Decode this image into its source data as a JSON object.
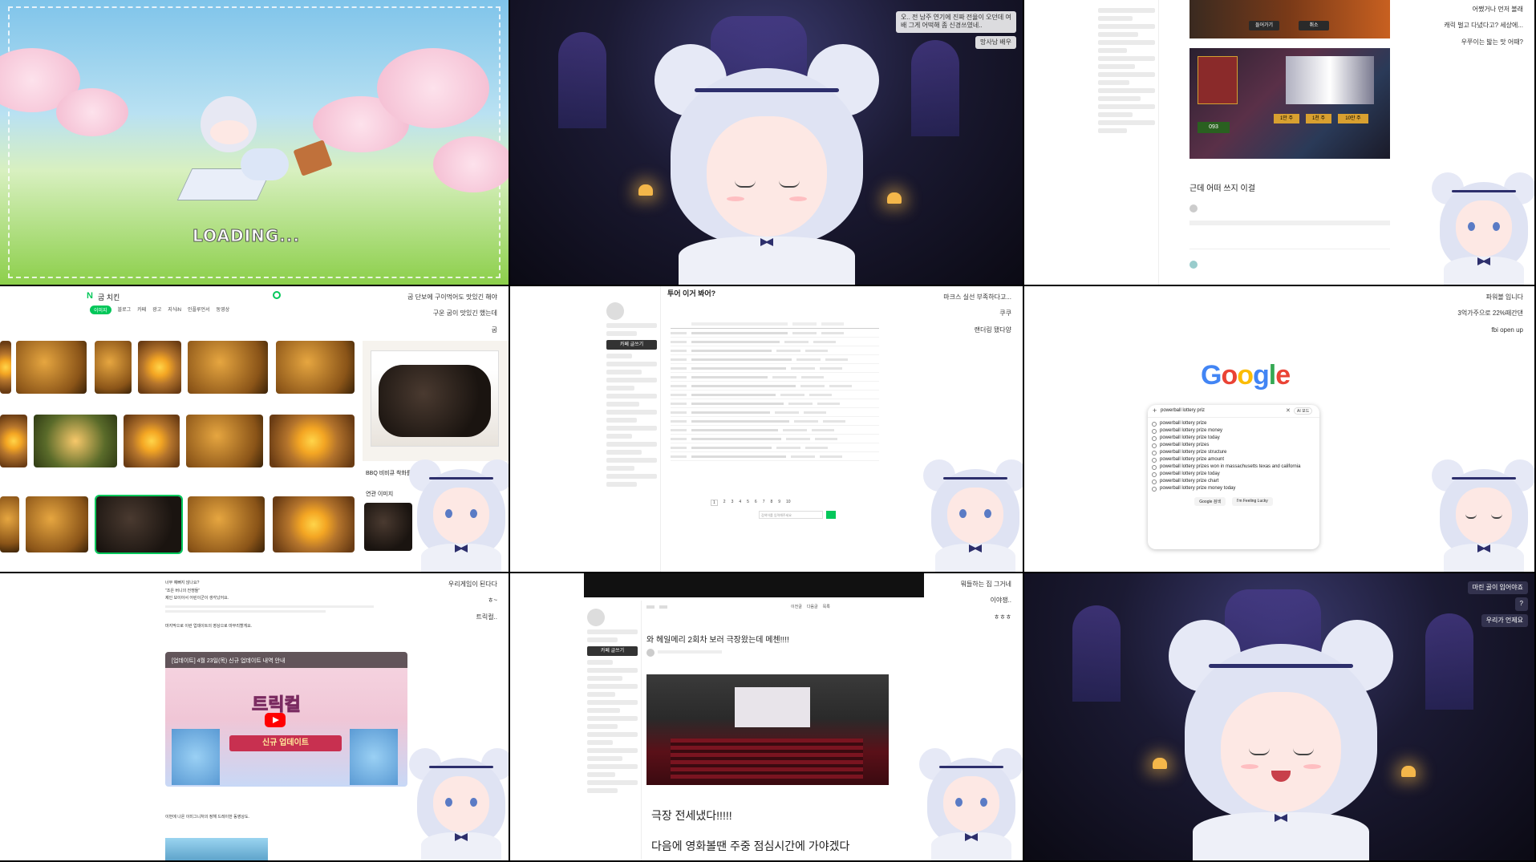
{
  "t1": {
    "loading": "LOADING..."
  },
  "t2": {
    "chat": [
      "오.. 전 남주 연기에 진짜 전율이 오던데 여배 그게 어떡해 좀 신경쓰였네..",
      "망사남 배우"
    ]
  },
  "t3": {
    "post_title": "근데 어떠 쓰지 이걸",
    "chat": [
      "어쨌거나 먼저 볼래",
      "캐릭 벌고 다녔다고? 세상에...",
      "우쭈이는 밟는 맛 어때?"
    ],
    "game_buttons": [
      "들어가기",
      "취소"
    ],
    "game_badges": [
      "1만 주",
      "1천 주",
      "10만 주",
      "093"
    ]
  },
  "t4": {
    "search_query": "굽 치킨",
    "tabs": [
      "이미지",
      "블로그",
      "카페",
      "광고",
      "지식iN",
      "인플루언서",
      "동영상"
    ],
    "chat": [
      "굽 단보에 구이먹어도 맛있긴 해야",
      "구운 굽이 맛있긴 했는데",
      "굽"
    ],
    "caption_right": "BBQ 비비큐 착화틀",
    "related": "연관 이미지"
  },
  "t5": {
    "board_title": "투어 이거 봐어?",
    "chat": [
      "마크스 실선 부족하다고...",
      "쿠쿠",
      "랜더링 됐다양"
    ],
    "write_button": "카페 글쓰기",
    "pages": [
      "1",
      "2",
      "3",
      "4",
      "5",
      "6",
      "7",
      "8",
      "9",
      "10"
    ],
    "search_placeholder": "검색어를 입력해주세요"
  },
  "t6": {
    "chat": [
      "파워볼 입니다",
      "3억가주으로 22%떼간댄",
      "fbi open up"
    ],
    "logo": "Google",
    "query": "powerball lottery priz",
    "suggestions": [
      "powerball lottery prize",
      "powerball lottery prize money",
      "powerball lottery prize today",
      "powerball lottery prizes",
      "powerball lottery prize structure",
      "powerball lottery prize amount",
      "powerball lottery prizes won in massachusetts texas and california",
      "powerball lottery prize today",
      "powerball lottery prize chart",
      "powerball lottery prize money today"
    ],
    "btn_search": "Google 검색",
    "btn_lucky": "I'm Feeling Lucky",
    "ai_mode": "AI 모드"
  },
  "t7": {
    "chat": [
      "우리게임이 된다다",
      "ㅎ~",
      "트릭컬.."
    ],
    "lines": [
      "너무 예뻐지 않나요?",
      "\"조은 버니의 전쟁들\"",
      "제인 보이아서 어린이군이 생각났어요.",
      "마지막으로 이런 업데이트의 영상으로 마무리할게요."
    ],
    "video_title": "[업데이트] 4월 23일(목) 신규 업데이트 내역 안내",
    "banner": "신규 업데이트",
    "logo": "트릭컬",
    "footer": "이번에 나온 이미그니처의 정해 드레이한 동영상도."
  },
  "t8": {
    "chat": [
      "뭐들하는 집 그거네",
      "이야쟁..",
      "ㅎㅎㅎ"
    ],
    "post_title": "와 헤일메리 2회차 보러 극장왔는데 메첸!!!!",
    "line1": "극장 전세냈다!!!!!",
    "line2": "다음에 영화볼땐 주중 점심시간에 가야겠다",
    "write_button": "카페 글쓰기",
    "nav": [
      "이전글",
      "다음글",
      "목록"
    ]
  },
  "t9": {
    "chat": [
      "마린 골이 입어야죠",
      "?",
      "우리가 언제요"
    ]
  },
  "colors": {
    "accent": "#03c75a",
    "navy": "#2d2f6c",
    "google_blue": "#4285f4",
    "google_red": "#ea4335",
    "google_yellow": "#fbbc05",
    "google_green": "#34a853"
  }
}
